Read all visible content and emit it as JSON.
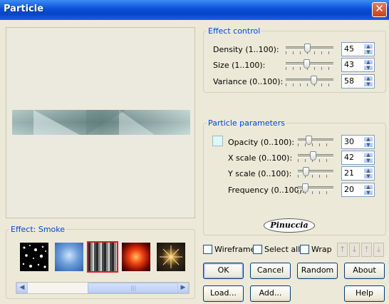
{
  "window": {
    "title": "Particle",
    "close_icon": "close-icon"
  },
  "effect_control": {
    "legend": "Effect control",
    "rows": [
      {
        "label": "Density (1..100):",
        "value": "45",
        "level": 45
      },
      {
        "label": "Size (1..100):",
        "value": "43",
        "level": 43
      },
      {
        "label": "Variance (0..100):",
        "value": "58",
        "level": 58
      }
    ]
  },
  "particle_parameters": {
    "legend": "Particle parameters",
    "color_swatch": "#dff7f5",
    "rows": [
      {
        "label": "Opacity (0..100):",
        "value": "30",
        "level": 30
      },
      {
        "label": "X scale (0..100):",
        "value": "42",
        "level": 42
      },
      {
        "label": "Y scale (0..100):",
        "value": "21",
        "level": 21
      },
      {
        "label": "Frequency (0..100):",
        "value": "20",
        "level": 20
      }
    ]
  },
  "logo_text": "Pinuccia",
  "effect_panel": {
    "legend": "Effect: Smoke",
    "thumbnails": [
      {
        "name": "stars-thumbnail",
        "selected": false
      },
      {
        "name": "sky-thumbnail",
        "selected": false
      },
      {
        "name": "smoke-thumbnail",
        "selected": true
      },
      {
        "name": "fire-thumbnail",
        "selected": false
      },
      {
        "name": "sparkle-thumbnail",
        "selected": false
      }
    ],
    "scroll_thumb_grip": "|||"
  },
  "options": {
    "wireframe": "Wireframe",
    "select_all": "Select all",
    "wrap": "Wrap",
    "arrows": [
      "↑",
      "↓",
      "⤒",
      "⤓"
    ]
  },
  "buttons": {
    "ok": "OK",
    "cancel": "Cancel",
    "random": "Random",
    "about": "About",
    "load": "Load...",
    "add": "Add...",
    "help": "Help"
  },
  "colors": {
    "title_bar": "#0a4fd6",
    "legend_text": "#0046d5",
    "selected_border": "#e11c1c"
  }
}
